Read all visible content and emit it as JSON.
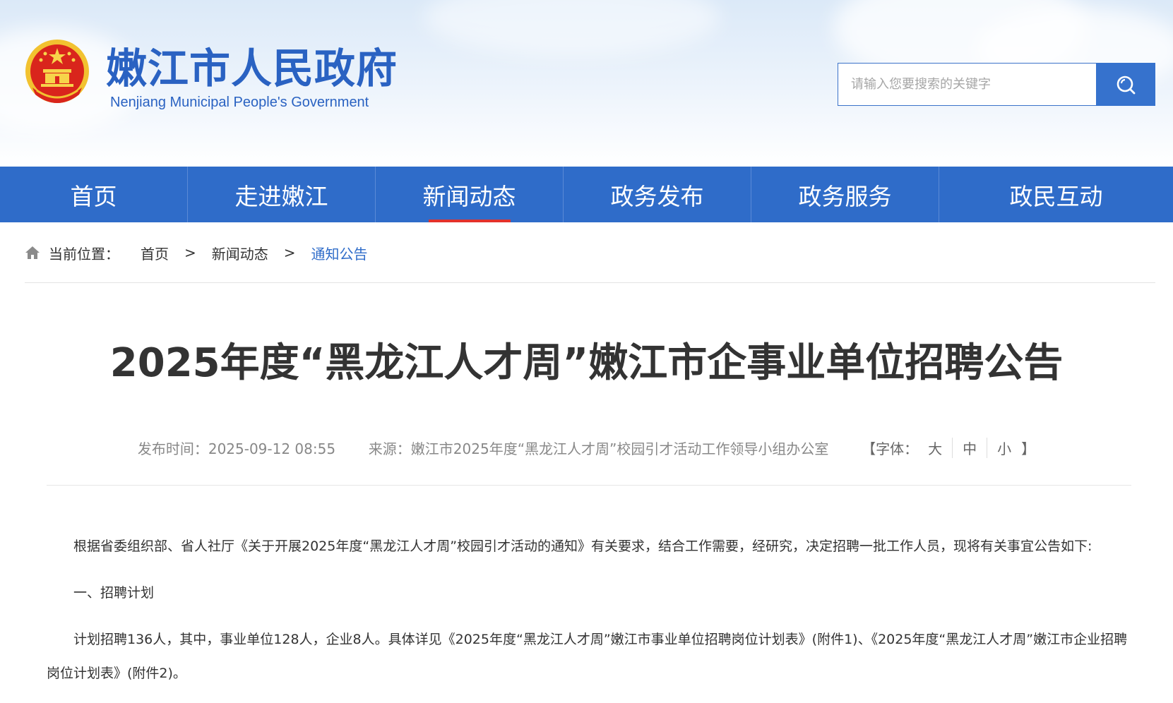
{
  "header": {
    "site_title": "嫩江市人民政府",
    "site_subtitle": "Nenjiang Municipal People's Government",
    "emblem_icon": "national-emblem-icon",
    "search": {
      "placeholder": "请输入您要搜索的关键字",
      "value": "",
      "button_icon": "search-icon"
    }
  },
  "nav": {
    "items": [
      {
        "label": "首页"
      },
      {
        "label": "走进嫩江"
      },
      {
        "label": "新闻动态"
      },
      {
        "label": "政务发布"
      },
      {
        "label": "政务服务"
      },
      {
        "label": "政民互动"
      }
    ],
    "active_index": 2,
    "colors": {
      "bar": "#2f6cc9",
      "active_underline": "#e3322b"
    }
  },
  "breadcrumb": {
    "prefix": "当前位置：",
    "items": [
      "首页",
      "新闻动态",
      "通知公告"
    ],
    "separator": ">",
    "icon": "home-icon"
  },
  "article": {
    "title": "2025年度“黑龙江人才周”嫩江市企事业单位招聘公告",
    "meta": {
      "published_label": "发布时间：",
      "published_value": "2025-09-12 08:55",
      "source_label": "来源：",
      "source_value": "嫩江市2025年度“黑龙江人才周”校园引才活动工作领导小组办公室",
      "font_label_open": "【字体：",
      "font_options": [
        "大",
        "中",
        "小"
      ],
      "font_label_close": "】"
    },
    "paragraphs": [
      "根据省委组织部、省人社厅《关于开展2025年度“黑龙江人才周”校园引才活动的通知》有关要求，结合工作需要，经研究，决定招聘一批工作人员，现将有关事宜公告如下:",
      "一、招聘计划",
      "计划招聘136人，其中，事业单位128人，企业8人。具体详见《2025年度“黑龙江人才周”嫩江市事业单位招聘岗位计划表》(附件1)、《2025年度“黑龙江人才周”嫩江市企业招聘岗位计划表》(附件2)。"
    ]
  }
}
